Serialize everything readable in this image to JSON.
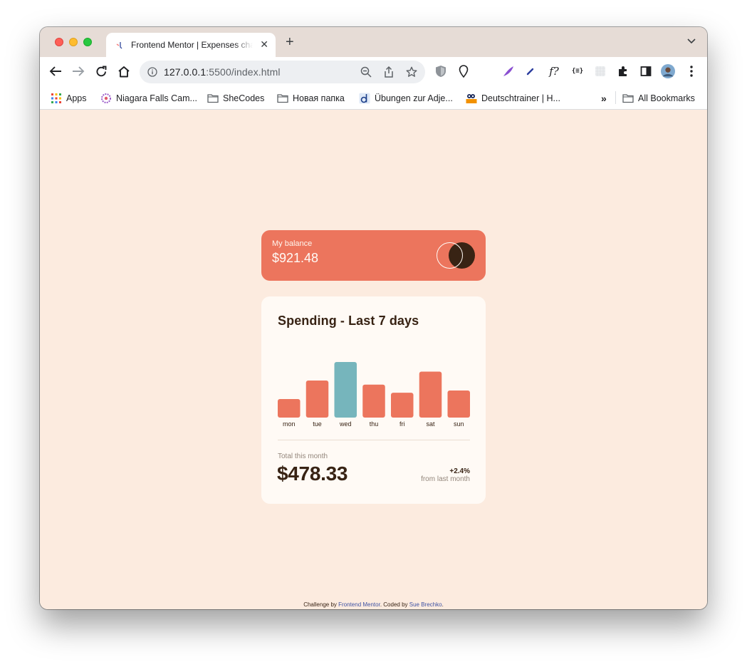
{
  "browser": {
    "tab_title": "Frontend Mentor | Expenses chart component",
    "url_host": "127.0.0.1",
    "url_path": ":5500/index.html",
    "bookmarks": [
      {
        "label": "Apps",
        "icon": "apps-grid-icon"
      },
      {
        "label": "Niagara Falls Cam...",
        "icon": "niagara-icon"
      },
      {
        "label": "SheCodes",
        "icon": "folder-icon"
      },
      {
        "label": "Новая папка",
        "icon": "folder-icon"
      },
      {
        "label": "Übungen zur Adje...",
        "icon": "d-site-icon"
      },
      {
        "label": "Deutschtrainer | H...",
        "icon": "goethe-icon"
      }
    ],
    "all_bookmarks_label": "All Bookmarks",
    "overflow_label": "»"
  },
  "balance": {
    "label": "My balance",
    "amount": "$921.48"
  },
  "spending": {
    "title": "Spending - Last 7 days",
    "total_label": "Total this month",
    "total": "$478.33",
    "change": "+2.4%",
    "change_label": "from last month"
  },
  "chart_data": {
    "type": "bar",
    "categories": [
      "mon",
      "tue",
      "wed",
      "thu",
      "fri",
      "sat",
      "sun"
    ],
    "values": [
      17.45,
      34.91,
      52.36,
      31.07,
      23.39,
      43.28,
      25.48
    ],
    "highlight_index": 2,
    "bar_color": "#ec755d",
    "highlight_color": "#76b5bc"
  },
  "footer": {
    "prefix": "Challenge by ",
    "link1": "Frontend Mentor",
    "middle": ". Coded by ",
    "link2": "Sue Brechko",
    "suffix": "."
  }
}
